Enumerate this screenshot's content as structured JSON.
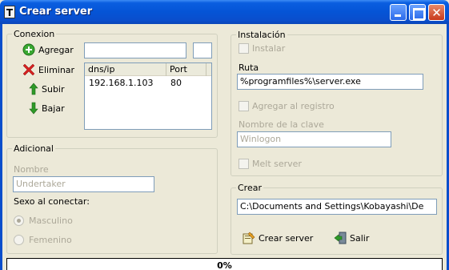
{
  "window": {
    "title": "Crear server",
    "app_icon": "T",
    "close_glyph": "✕"
  },
  "conexion": {
    "title": "Conexion",
    "buttons": {
      "agregar": "Agregar",
      "eliminar": "Eliminar",
      "subir": "Subir",
      "bajar": "Bajar"
    },
    "host_input": "",
    "port_input": "",
    "list": {
      "columns": [
        "dns/ip",
        "Port"
      ],
      "rows": [
        {
          "host": "192.168.1.103",
          "port": "80"
        }
      ]
    }
  },
  "adicional": {
    "title": "Adicional",
    "nombre_label": "Nombre",
    "nombre_value": "Undertaker",
    "sexo_label": "Sexo al conectar:",
    "options": [
      "Masculino",
      "Femenino"
    ],
    "selected": "Masculino"
  },
  "instalacion": {
    "title": "Instalación",
    "instalar_label": "Instalar",
    "ruta_label": "Ruta",
    "ruta_value": "%programfiles%\\server.exe",
    "registro_label": "Agregar al registro",
    "clave_label": "Nombre de la clave",
    "clave_value": "Winlogon",
    "melt_label": "Melt server"
  },
  "crear": {
    "title": "Crear",
    "path_value": "C:\\Documents and Settings\\Kobayashi\\De",
    "crear_button": "Crear server",
    "salir_button": "Salir"
  },
  "progress": {
    "text": "0%",
    "value": 0
  },
  "colors": {
    "titlebar": "#0554d6",
    "background": "#ece9d8",
    "add_green": "#3aa832",
    "delete_red": "#d42020",
    "arrow_green": "#2e9a28"
  }
}
